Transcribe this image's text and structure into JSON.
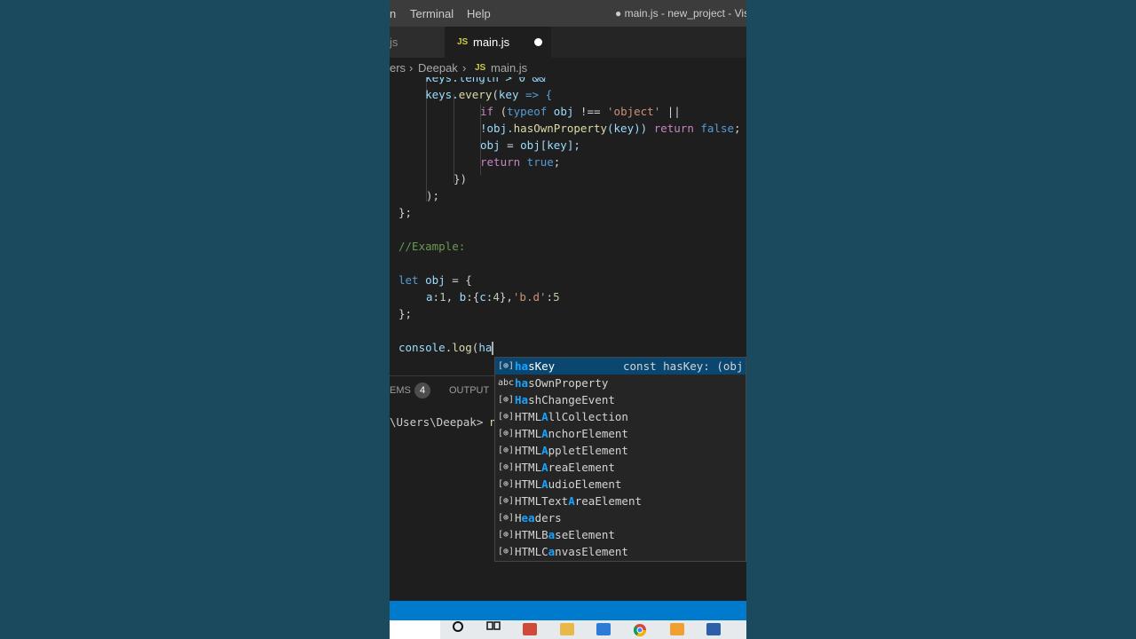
{
  "titlebar": {
    "menu": [
      "n",
      "Terminal",
      "Help"
    ],
    "title": "● main.js - new_project - Vis"
  },
  "tabs": {
    "inactive_label": "js",
    "active_label": "main.js",
    "active_badge": "JS"
  },
  "breadcrumb": {
    "parts": [
      "ers",
      "›",
      "Deepak",
      "›"
    ],
    "file_badge": "JS",
    "file": "main.js"
  },
  "code": {
    "line0": "    keys.length > 0 &&",
    "line1_a": "    keys.",
    "line1_b": "every",
    "line1_c": "(",
    "line1_d": "key",
    "line1_e": " => {",
    "line2_a": "if",
    "line2_b": " (",
    "line2_c": "typeof",
    "line2_d": " obj",
    "line2_e": " !== ",
    "line2_f": "'object'",
    "line2_g": " ||",
    "line3_a": "!obj.",
    "line3_b": "hasOwnProperty",
    "line3_c": "(key)) ",
    "line3_d": "return",
    "line3_e": " false",
    "line3_f": ";",
    "line4_a": "obj",
    "line4_b": " = ",
    "line4_c": "obj",
    "line4_d": "[key];",
    "line5_a": "return",
    "line5_b": " true",
    "line5_c": ";",
    "line6": "})",
    "line7": ");",
    "line8": "};",
    "line9": "//Example:",
    "line10_a": "let",
    "line10_b": " obj",
    "line10_c": " = {",
    "line11_a": "a",
    "line11_b": ":",
    "line11_c": "1",
    "line11_d": ", ",
    "line11_e": "b",
    "line11_f": ":{",
    "line11_g": "c",
    "line11_h": ":",
    "line11_i": "4",
    "line11_j": "},",
    "line11_k": "'b.d'",
    "line11_l": ":",
    "line11_m": "5",
    "line12": "};",
    "line13_a": "console",
    "line13_b": ".",
    "line13_c": "log",
    "line13_d": "(",
    "line13_e": "ha"
  },
  "panel": {
    "problems_label": "EMS",
    "problems_count": "4",
    "output_label": "OUTPUT",
    "terminal_prompt": "\\Users\\Deepak> ",
    "terminal_cmd": "n"
  },
  "suggest": {
    "detail": "const hasKey: (obj",
    "items": [
      {
        "icon": "[⊕]",
        "hl": "ha",
        "rest": "sKey"
      },
      {
        "icon": "abc",
        "hl": "ha",
        "rest": "sOwnProperty"
      },
      {
        "icon": "[⊕]",
        "hl": "Ha",
        "rest": "shChangeEvent"
      },
      {
        "icon": "[⊕]",
        "pre": "HTML",
        "hl": "A",
        "rest": "llCollection"
      },
      {
        "icon": "[⊕]",
        "pre": "HTML",
        "hl": "A",
        "rest": "nchorElement"
      },
      {
        "icon": "[⊕]",
        "pre": "HTML",
        "hl": "A",
        "rest": "ppletElement"
      },
      {
        "icon": "[⊕]",
        "pre": "HTML",
        "hl": "A",
        "rest": "reaElement"
      },
      {
        "icon": "[⊕]",
        "pre": "HTML",
        "hl": "A",
        "rest": "udioElement"
      },
      {
        "icon": "[⊕]",
        "pre": "HTMLText",
        "hl": "A",
        "rest": "reaElement"
      },
      {
        "icon": "[⊕]",
        "pre": "H",
        "hl": "ea",
        "rest": "ders"
      },
      {
        "icon": "[⊕]",
        "pre": "HTMLB",
        "hl": "a",
        "rest": "seElement"
      },
      {
        "icon": "[⊕]",
        "pre": "HTMLC",
        "hl": "a",
        "rest": "nvasElement"
      }
    ]
  },
  "colors": {
    "statusbar": "#007acc",
    "highlight": "#18a3ff",
    "selected_row": "#094771"
  }
}
